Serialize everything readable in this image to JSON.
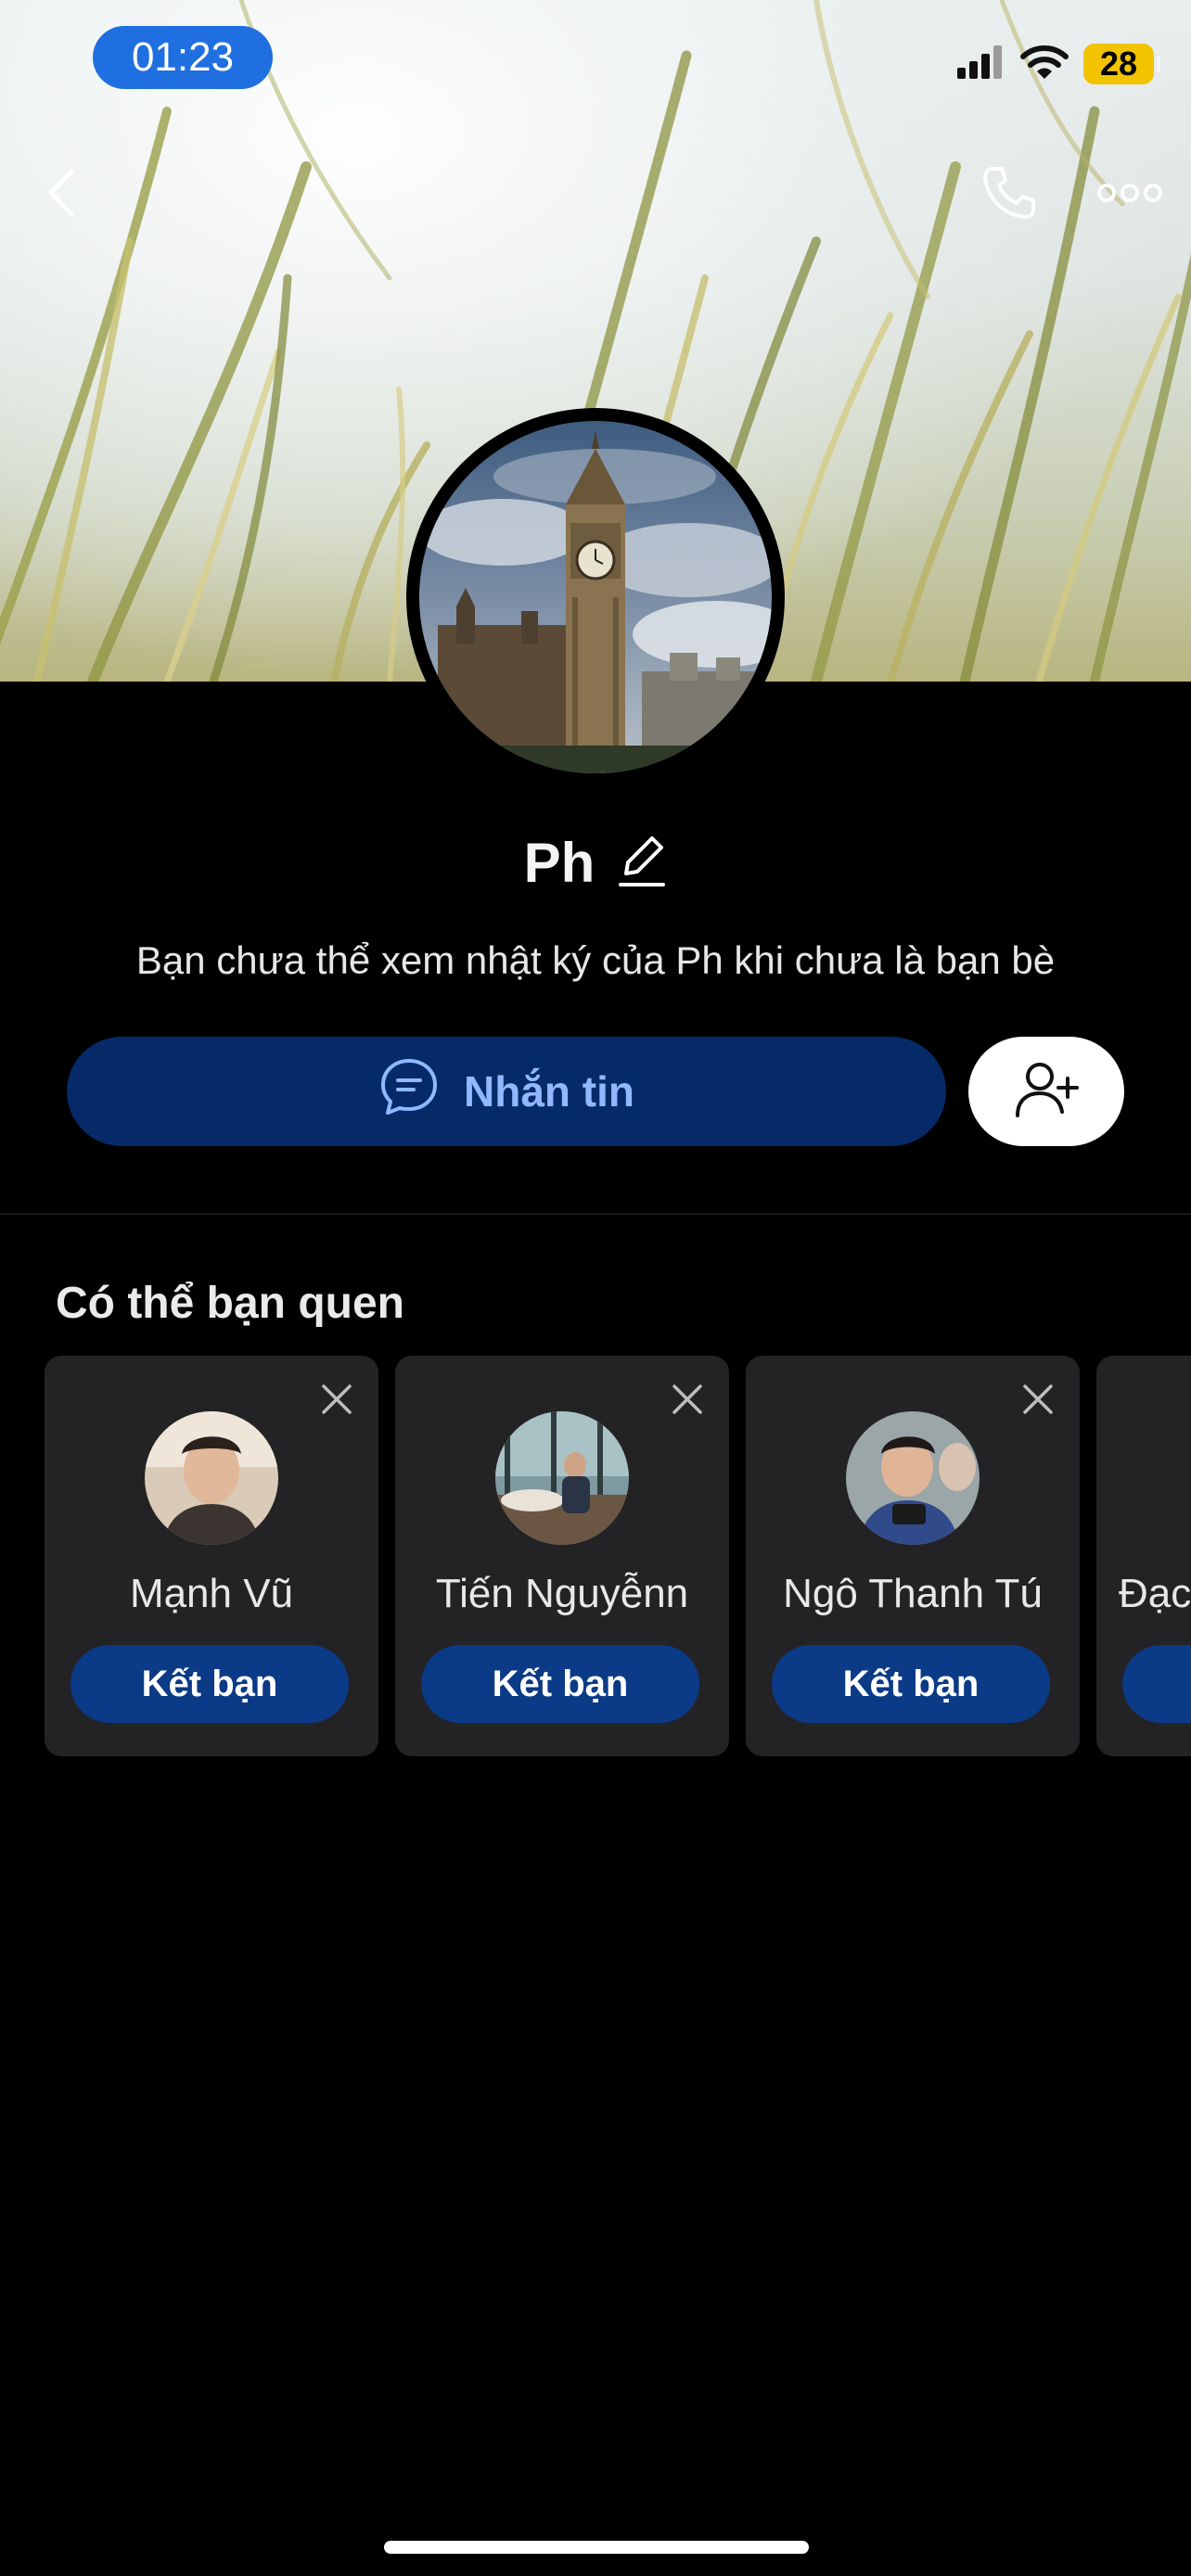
{
  "status_bar": {
    "time": "01:23",
    "battery": "28",
    "icons": [
      "cellular-signal-icon",
      "wifi-icon",
      "battery-icon"
    ]
  },
  "header": {
    "icons": [
      "back-chevron-icon",
      "phone-icon",
      "more-dots-icon"
    ]
  },
  "profile": {
    "name": "Ph",
    "subtitle": "Bạn chưa thể xem nhật ký của Ph khi chưa là bạn bè",
    "message_button": "Nhắn tin",
    "add_friend_icon": "add-user-icon",
    "edit_icon": "pencil-icon"
  },
  "suggestions": {
    "title": "Có thể bạn quen",
    "items": [
      {
        "name": "Mạnh Vũ",
        "button": "Kết bạn"
      },
      {
        "name": "Tiến Nguyễnn",
        "button": "Kết bạn"
      },
      {
        "name": "Ngô Thanh Tú",
        "button": "Kết bạn"
      },
      {
        "name": "Đạc",
        "button": ""
      }
    ]
  },
  "colors": {
    "accent": "#1f6fe0",
    "message_button_bg": "#052a67",
    "message_button_text": "#8fb8ff",
    "card_bg": "#232325",
    "card_button_bg": "#0b3a86",
    "battery": "#f2c300"
  }
}
